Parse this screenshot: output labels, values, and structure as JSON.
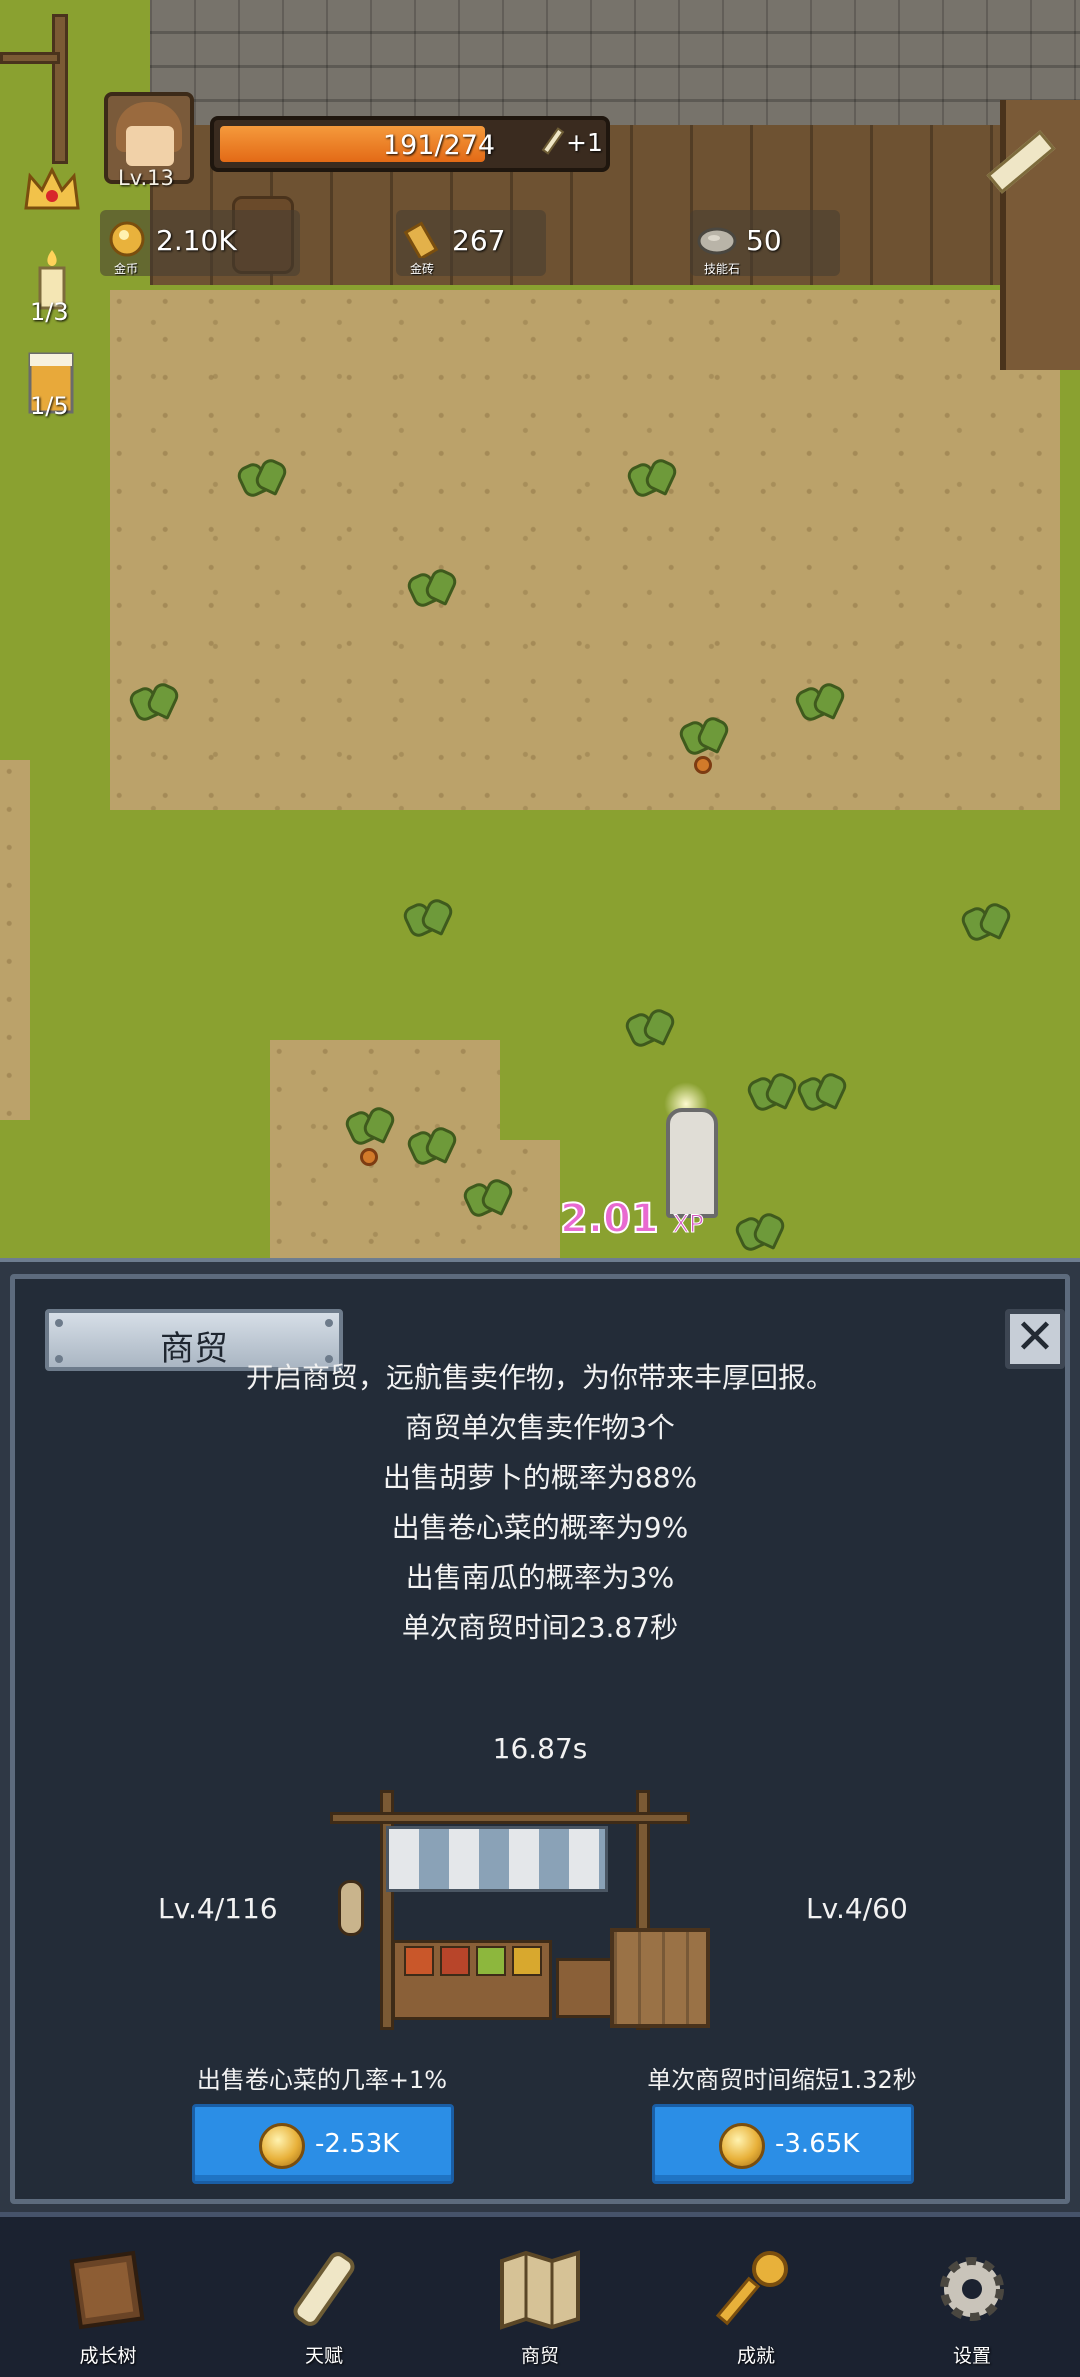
{
  "hud": {
    "level": "Lv.13",
    "xp_text": "191/274",
    "xp_fraction": 0.697,
    "xp_bonus": "+1",
    "resources": [
      {
        "label": "金币",
        "value": "2.10K",
        "icon": "gold-coin-icon"
      },
      {
        "label": "金砖",
        "value": "267",
        "icon": "gold-brick-icon"
      },
      {
        "label": "技能石",
        "value": "50",
        "icon": "skill-stone-icon"
      }
    ],
    "side": [
      {
        "icon": "crown-icon"
      },
      {
        "icon": "candle-icon",
        "count": "1/3"
      },
      {
        "icon": "beer-icon",
        "count": "1/5"
      }
    ]
  },
  "scene": {
    "xp_popup_value": "2.01",
    "xp_popup_unit": "XP"
  },
  "panel": {
    "title": "商贸",
    "close_icon": "close-icon",
    "description": [
      "开启商贸，远航售卖作物，为你带来丰厚回报。",
      "商贸单次售卖作物3个",
      "出售胡萝卜的概率为88%",
      "出售卷心菜的概率为9%",
      "出售南瓜的概率为3%",
      "单次商贸时间23.87秒"
    ],
    "timer": "16.87s",
    "upgrades": [
      {
        "level": "Lv.4/116",
        "desc": "出售卷心菜的几率+1%",
        "cost": "-2.53K"
      },
      {
        "level": "Lv.4/60",
        "desc": "单次商贸时间缩短1.32秒",
        "cost": "-3.65K"
      }
    ]
  },
  "nav": {
    "items": [
      {
        "label": "成长树",
        "icon": "book-icon"
      },
      {
        "label": "天赋",
        "icon": "scroll-icon"
      },
      {
        "label": "商贸",
        "icon": "map-icon"
      },
      {
        "label": "成就",
        "icon": "key-icon"
      },
      {
        "label": "设置",
        "icon": "gear-icon"
      }
    ]
  },
  "colors": {
    "xp_bar": "#ee7d26",
    "button_blue": "#2b8ee6",
    "panel_bg": "#232c38",
    "xp_popup": "#e86ad0"
  }
}
